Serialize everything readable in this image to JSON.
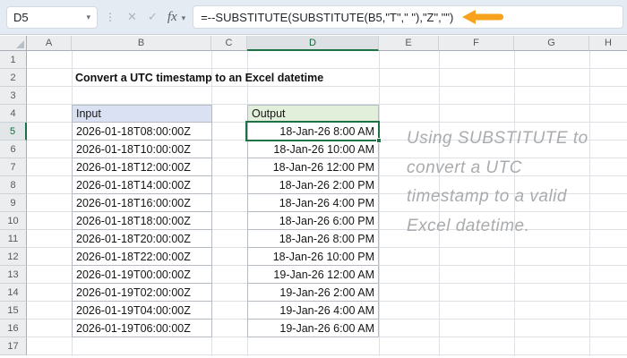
{
  "formula_bar": {
    "cell_reference": "D5",
    "menu_dots": "⋮",
    "cancel_icon": "✕",
    "enter_icon": "✓",
    "fx_label": "fx",
    "chevron": "▾",
    "formula": "=--SUBSTITUTE(SUBSTITUTE(B5,\"T\",\" \"),\"Z\",\"\")"
  },
  "grid": {
    "column_headers": [
      "A",
      "B",
      "C",
      "D",
      "E",
      "F",
      "G",
      "H"
    ],
    "row_headers": [
      "1",
      "2",
      "3",
      "4",
      "5",
      "6",
      "7",
      "8",
      "9",
      "10",
      "11",
      "12",
      "13",
      "14",
      "15",
      "16",
      "17"
    ],
    "selected_cell": "D5",
    "selected_column": "D",
    "selected_row": "5"
  },
  "content": {
    "title": "Convert a UTC timestamp to an Excel datetime",
    "input_table": {
      "header": "Input",
      "values": [
        "2026-01-18T08:00:00Z",
        "2026-01-18T10:00:00Z",
        "2026-01-18T12:00:00Z",
        "2026-01-18T14:00:00Z",
        "2026-01-18T16:00:00Z",
        "2026-01-18T18:00:00Z",
        "2026-01-18T20:00:00Z",
        "2026-01-18T22:00:00Z",
        "2026-01-19T00:00:00Z",
        "2026-01-19T02:00:00Z",
        "2026-01-19T04:00:00Z",
        "2026-01-19T06:00:00Z"
      ]
    },
    "output_table": {
      "header": "Output",
      "values": [
        "18-Jan-26 8:00 AM",
        "18-Jan-26 10:00 AM",
        "18-Jan-26 12:00 PM",
        "18-Jan-26 2:00 PM",
        "18-Jan-26 4:00 PM",
        "18-Jan-26 6:00 PM",
        "18-Jan-26 8:00 PM",
        "18-Jan-26 10:00 PM",
        "19-Jan-26 12:00 AM",
        "19-Jan-26 2:00 AM",
        "19-Jan-26 4:00 AM",
        "19-Jan-26 6:00 AM"
      ]
    },
    "annotation": {
      "lines": [
        "Using SUBSTITUTE to",
        "convert a UTC",
        "timestamp to a valid",
        "Excel datetime."
      ]
    }
  },
  "colors": {
    "accent_green": "#1E7145",
    "input_header_bg": "#D9E1F2",
    "output_header_bg": "#E2EFDA",
    "arrow_orange": "#F6A21D",
    "annotation_gray": "#A9ABAD"
  }
}
